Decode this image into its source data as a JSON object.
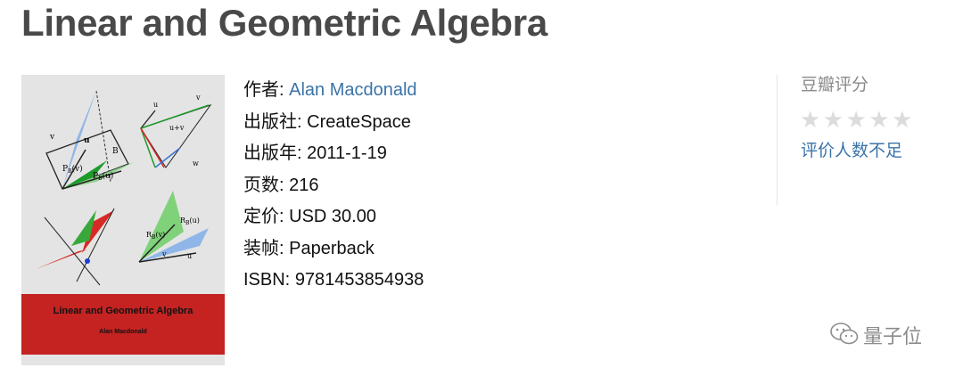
{
  "book": {
    "title": "Linear and Geometric Algebra",
    "cover": {
      "title": "Linear and Geometric Algebra",
      "author": "Alan Macdonald"
    },
    "info": [
      {
        "label": "作者:",
        "value": "Alan Macdonald",
        "is_link": true
      },
      {
        "label": "出版社:",
        "value": "CreateSpace"
      },
      {
        "label": "出版年:",
        "value": "2011-1-19"
      },
      {
        "label": "页数:",
        "value": "216"
      },
      {
        "label": "定价:",
        "value": "USD 30.00"
      },
      {
        "label": "装帧:",
        "value": "Paperback"
      },
      {
        "label": "ISBN:",
        "value": "9781453854938"
      }
    ]
  },
  "rating": {
    "title": "豆瓣评分",
    "stars_filled": 0,
    "stars_total": 5,
    "status_link": "评价人数不足"
  },
  "watermark": {
    "icon": "wechat-icon",
    "text": "量子位"
  },
  "colors": {
    "title": "#494949",
    "link": "#3b73a8",
    "cover_band": "#c42322",
    "star_empty": "#dcdcdc"
  }
}
